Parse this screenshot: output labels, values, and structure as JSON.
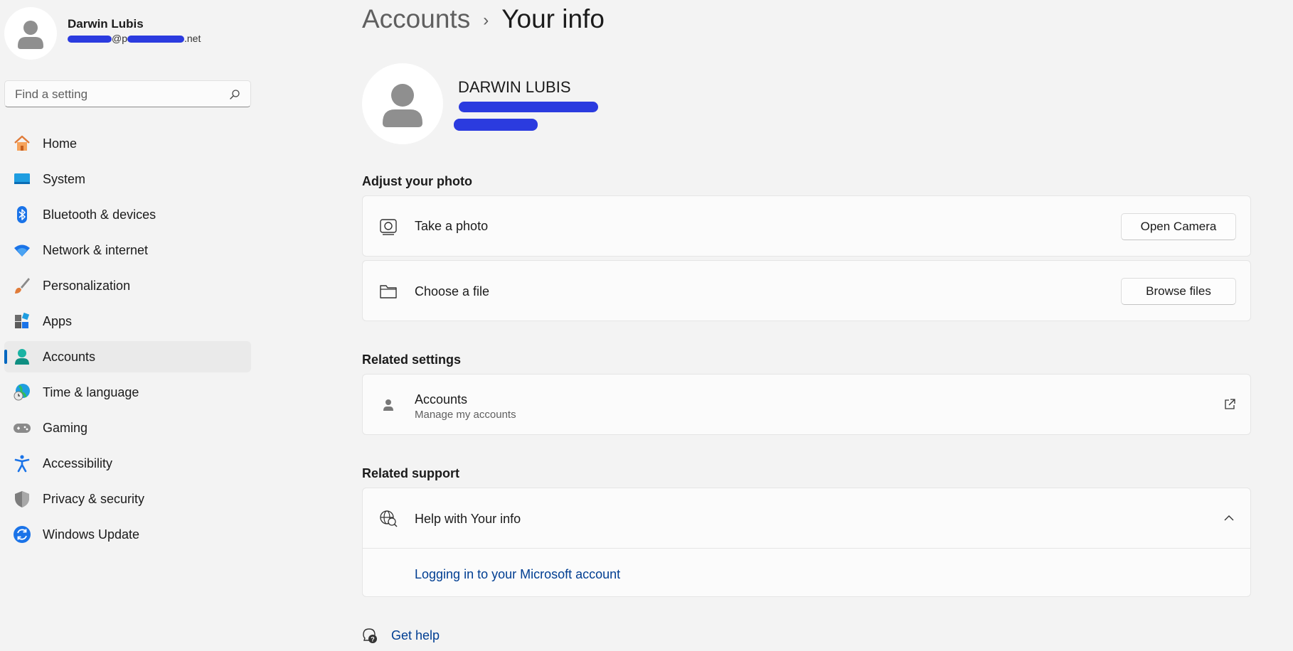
{
  "sidebar": {
    "user": {
      "name": "Darwin Lubis",
      "email_visible_start": "@p",
      "email_visible_end": ".net"
    },
    "search": {
      "placeholder": "Find a setting"
    },
    "items": [
      {
        "label": "Home",
        "icon": "home-icon"
      },
      {
        "label": "System",
        "icon": "system-icon"
      },
      {
        "label": "Bluetooth & devices",
        "icon": "bluetooth-icon"
      },
      {
        "label": "Network & internet",
        "icon": "wifi-icon"
      },
      {
        "label": "Personalization",
        "icon": "brush-icon"
      },
      {
        "label": "Apps",
        "icon": "apps-icon"
      },
      {
        "label": "Accounts",
        "icon": "accounts-icon",
        "active": true
      },
      {
        "label": "Time & language",
        "icon": "globe-clock-icon"
      },
      {
        "label": "Gaming",
        "icon": "gamepad-icon"
      },
      {
        "label": "Accessibility",
        "icon": "accessibility-icon"
      },
      {
        "label": "Privacy & security",
        "icon": "shield-icon"
      },
      {
        "label": "Windows Update",
        "icon": "update-icon"
      }
    ]
  },
  "breadcrumb": {
    "parent": "Accounts",
    "separator": "›",
    "current": "Your info"
  },
  "profile": {
    "name": "DARWIN LUBIS"
  },
  "adjust_photo": {
    "title": "Adjust your photo",
    "take_photo": {
      "label": "Take a photo",
      "button": "Open Camera"
    },
    "choose_file": {
      "label": "Choose a file",
      "button": "Browse files"
    }
  },
  "related_settings": {
    "title": "Related settings",
    "accounts": {
      "label": "Accounts",
      "sub": "Manage my accounts"
    }
  },
  "related_support": {
    "title": "Related support",
    "help": {
      "label": "Help with Your info",
      "link": "Logging in to your Microsoft account"
    }
  },
  "get_help": {
    "label": "Get help"
  },
  "colors": {
    "accent": "#0067c0",
    "link": "#003e92",
    "background": "#f3f3f3",
    "card": "#fbfbfb"
  }
}
